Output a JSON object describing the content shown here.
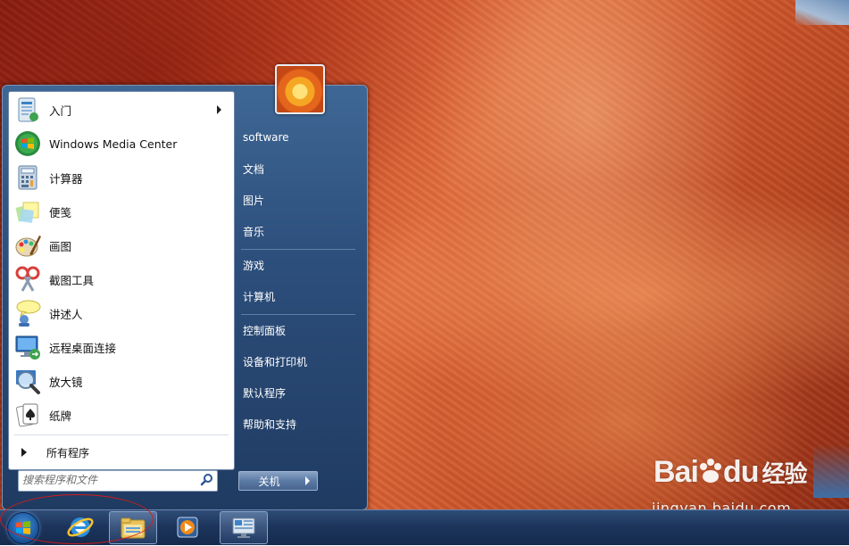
{
  "start_menu": {
    "programs": [
      {
        "label": "入门",
        "icon": "getting-started-icon",
        "has_submenu": true
      },
      {
        "label": "Windows Media Center",
        "icon": "windows-media-center-icon",
        "has_submenu": false
      },
      {
        "label": "计算器",
        "icon": "calculator-icon",
        "has_submenu": false
      },
      {
        "label": "便笺",
        "icon": "sticky-notes-icon",
        "has_submenu": false
      },
      {
        "label": "画图",
        "icon": "paint-icon",
        "has_submenu": false
      },
      {
        "label": "截图工具",
        "icon": "snipping-tool-icon",
        "has_submenu": false
      },
      {
        "label": "讲述人",
        "icon": "narrator-icon",
        "has_submenu": false
      },
      {
        "label": "远程桌面连接",
        "icon": "remote-desktop-icon",
        "has_submenu": false
      },
      {
        "label": "放大镜",
        "icon": "magnifier-icon",
        "has_submenu": false
      },
      {
        "label": "纸牌",
        "icon": "solitaire-icon",
        "has_submenu": false
      }
    ],
    "all_programs_label": "所有程序",
    "search": {
      "placeholder": "搜索程序和文件"
    },
    "right_items": [
      {
        "label": "software"
      },
      {
        "label": "文档"
      },
      {
        "label": "图片"
      },
      {
        "label": "音乐"
      },
      {
        "label": "游戏"
      },
      {
        "label": "计算机"
      },
      {
        "label": "控制面板"
      },
      {
        "label": "设备和打印机"
      },
      {
        "label": "默认程序"
      },
      {
        "label": "帮助和支持"
      }
    ],
    "shutdown_label": "关机"
  },
  "taskbar": {
    "items": [
      {
        "name": "internet-explorer",
        "icon": "internet-explorer-icon",
        "active": false
      },
      {
        "name": "windows-explorer",
        "icon": "folder-icon",
        "active": true
      },
      {
        "name": "windows-media-player",
        "icon": "media-player-icon",
        "active": false
      },
      {
        "name": "remote-desktop",
        "icon": "remote-desktop-icon",
        "active": true
      }
    ]
  },
  "watermark": {
    "logo": "Bai",
    "logo_suffix": "du",
    "logo_cn": "经验",
    "url": "jingyan.baidu.com"
  },
  "colors": {
    "menu_blue": "#2d4f7c",
    "taskbar": "#1d355c",
    "highlight_ellipse": "#d21b1b"
  }
}
